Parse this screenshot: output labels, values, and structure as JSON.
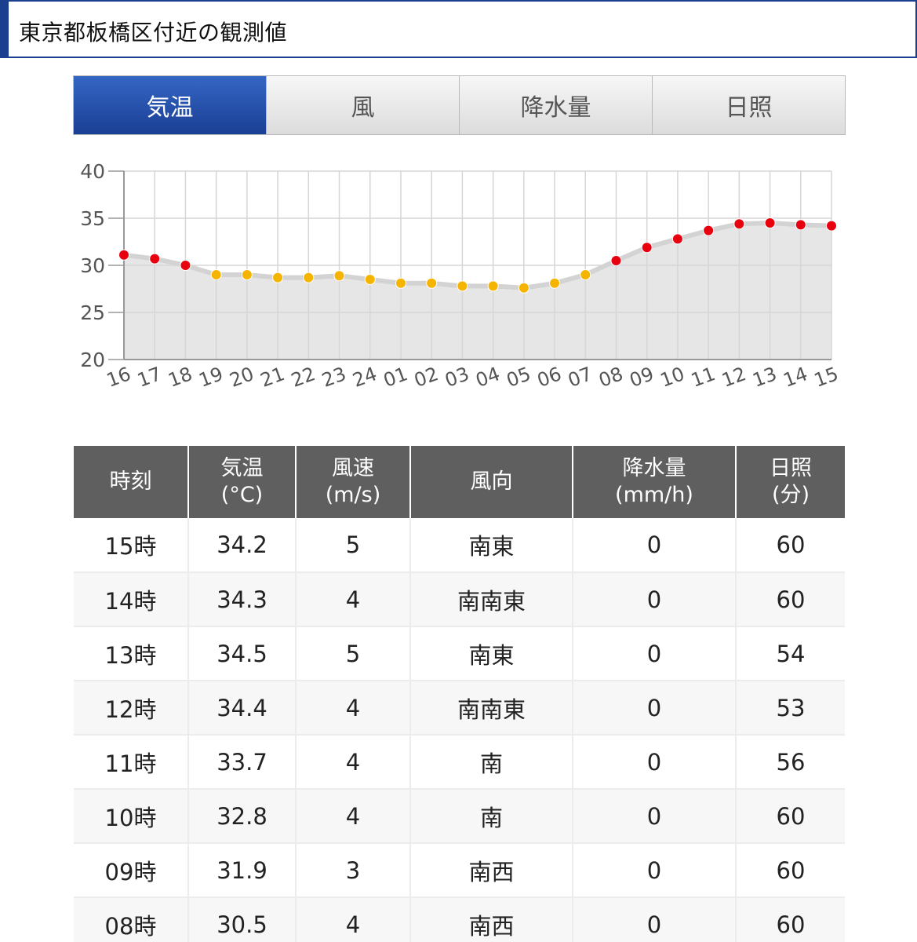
{
  "header": {
    "title": "東京都板橋区付近の観測値"
  },
  "tabs": [
    {
      "label": "気温",
      "active": true
    },
    {
      "label": "風",
      "active": false
    },
    {
      "label": "降水量",
      "active": false
    },
    {
      "label": "日照",
      "active": false
    }
  ],
  "chart_data": {
    "type": "line",
    "x": [
      "16",
      "17",
      "18",
      "19",
      "20",
      "21",
      "22",
      "23",
      "24",
      "01",
      "02",
      "03",
      "04",
      "05",
      "06",
      "07",
      "08",
      "09",
      "10",
      "11",
      "12",
      "13",
      "14",
      "15"
    ],
    "series": [
      {
        "values": [
          31.1,
          30.7,
          30.0,
          29.0,
          29.0,
          28.7,
          28.7,
          28.9,
          28.5,
          28.1,
          28.1,
          27.8,
          27.8,
          27.6,
          28.1,
          29.0,
          30.5,
          31.9,
          32.8,
          33.7,
          34.4,
          34.5,
          34.3,
          34.2
        ]
      }
    ],
    "ylim": [
      20,
      40
    ],
    "yticks": [
      20,
      25,
      30,
      35,
      40
    ],
    "grid": true,
    "colors": {
      "hot": "#e8000f",
      "normal": "#f5b400",
      "fill": "#e6e6e6",
      "line": "#d3d3d3",
      "grid": "#d6d6d6"
    },
    "hot_threshold": 30
  },
  "table": {
    "headers": [
      {
        "line1": "時刻",
        "line2": ""
      },
      {
        "line1": "気温",
        "line2": "(°C)"
      },
      {
        "line1": "風速",
        "line2": "(m/s)"
      },
      {
        "line1": "風向",
        "line2": ""
      },
      {
        "line1": "降水量",
        "line2": "(mm/h)"
      },
      {
        "line1": "日照",
        "line2": "(分)"
      }
    ],
    "rows": [
      [
        "15時",
        "34.2",
        "5",
        "南東",
        "0",
        "60"
      ],
      [
        "14時",
        "34.3",
        "4",
        "南南東",
        "0",
        "60"
      ],
      [
        "13時",
        "34.5",
        "5",
        "南東",
        "0",
        "54"
      ],
      [
        "12時",
        "34.4",
        "4",
        "南南東",
        "0",
        "53"
      ],
      [
        "11時",
        "33.7",
        "4",
        "南",
        "0",
        "56"
      ],
      [
        "10時",
        "32.8",
        "4",
        "南",
        "0",
        "60"
      ],
      [
        "09時",
        "31.9",
        "3",
        "南西",
        "0",
        "60"
      ],
      [
        "08時",
        "30.5",
        "4",
        "南西",
        "0",
        "60"
      ]
    ]
  }
}
